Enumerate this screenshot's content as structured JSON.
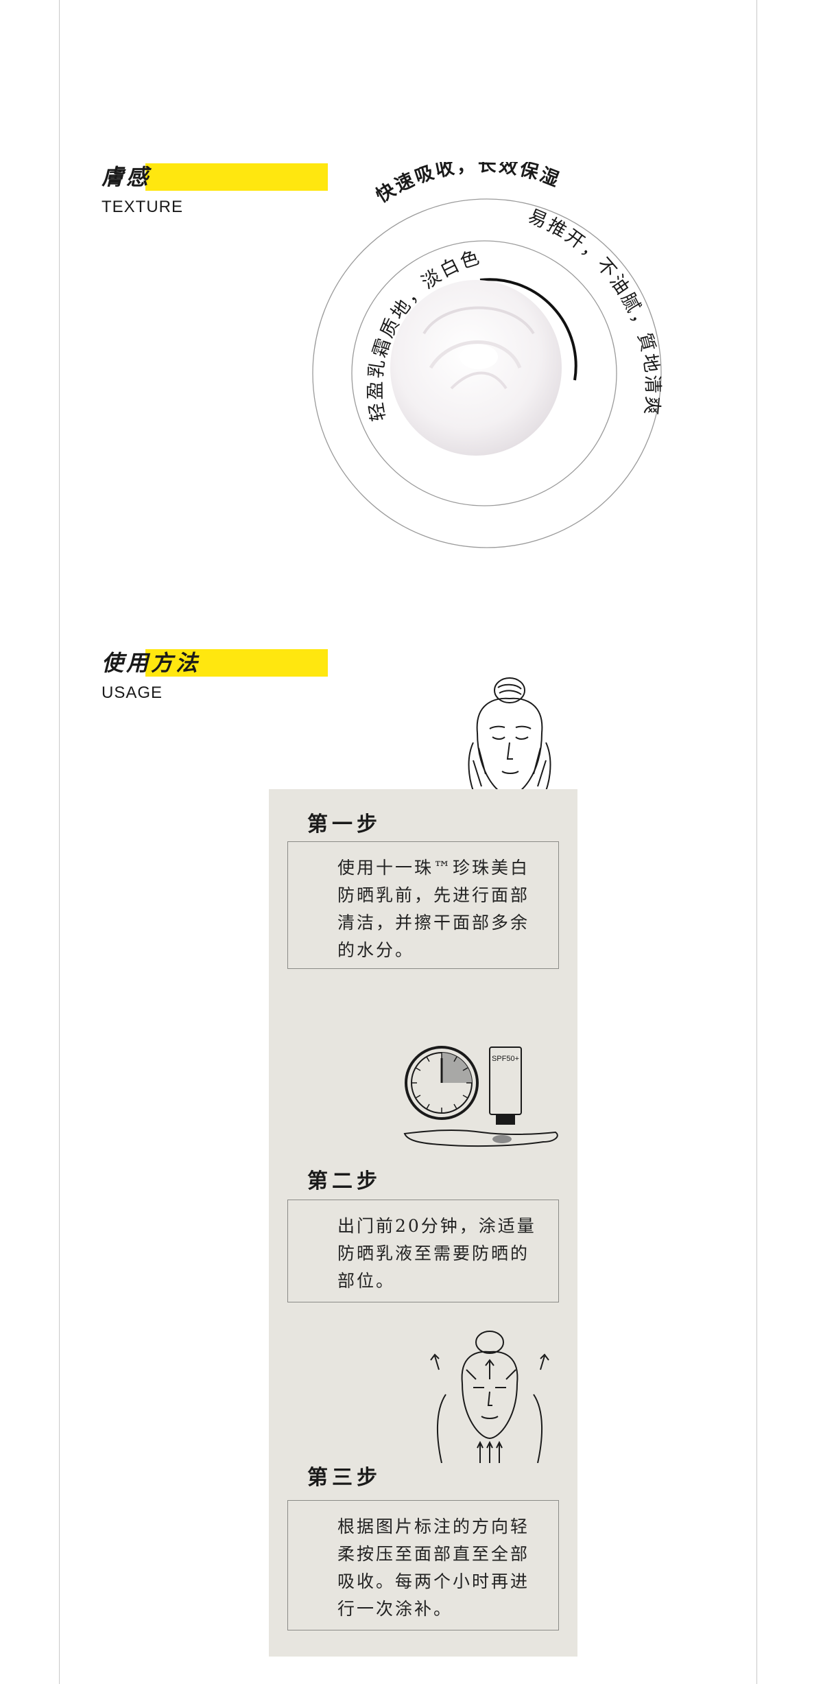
{
  "texture": {
    "title_cn": "膚感",
    "title_en": "TEXTURE",
    "outer_arc_label": "快速吸收，长效保湿",
    "right_arc_label": "易推开，不油腻，質地清爽",
    "inner_arc_label": "轻盈乳霜质地，淡白色"
  },
  "usage": {
    "title_cn": "使用方法",
    "title_en": "USAGE",
    "steps": [
      {
        "title": "第一步",
        "text": "使用十一珠™珍珠美白防晒乳前，先进行面部清洁，并擦干面部多余的水分。"
      },
      {
        "title": "第二步",
        "text": "出门前20分钟，涂适量防晒乳液至需要防晒的部位。"
      },
      {
        "title": "第三步",
        "text": "根据图片标注的方向轻柔按压至面部直至全部吸收。每两个小时再进行一次涂补。"
      }
    ],
    "tube_label": "SPF50+"
  },
  "colors": {
    "accent_yellow": "#ffe70f",
    "panel_bg": "#e7e5df",
    "frame_line": "#c8c8c8"
  }
}
